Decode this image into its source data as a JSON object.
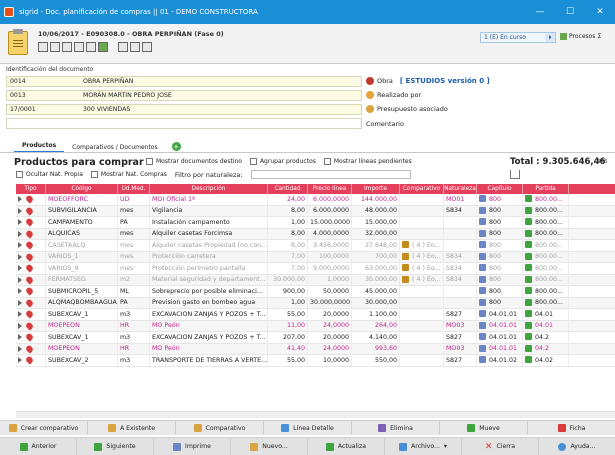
{
  "window": {
    "title": "sigrid - Doc. planificación de compras || 01 - DEMO CONSTRUCTORA",
    "min": "—",
    "max": "☐",
    "close": "✕"
  },
  "header": {
    "doc_title": "10/06/2017 - E090308.0 - OBRA PERPIÑAN (Fase 0)",
    "status": "1 (E) En curso",
    "status_arrow": "⏵",
    "procesos": "Procesos",
    "sigma": "Σ"
  },
  "ident": {
    "label": "Identificación del documento",
    "rows": [
      {
        "code": "0014",
        "name": "OBRA PERPIÑAN"
      },
      {
        "code": "0013",
        "name": "MORÁN MARTIN PEDRO JOSE"
      },
      {
        "code": "17/0001",
        "name": "300 VIVIENDAS"
      },
      {
        "code": "",
        "name": ""
      }
    ],
    "side": {
      "obra": "Obra",
      "estudios": "[ ESTUDIOS versión 0 ]",
      "realizado": "Realizado por",
      "presupuesto": "Presupuesto asociado",
      "comentario": "Comentario"
    }
  },
  "tabs": {
    "productos": "Productos",
    "comparativos": "Comparativos / Documentos",
    "add": "+"
  },
  "products": {
    "title": "Productos para comprar",
    "opt_mostrar_docs": "Mostrar documentos destino",
    "opt_agrupar": "Agrupar productos",
    "opt_lineas": "Mostrar líneas pendientes",
    "opt_ocultar": "Ocultar Nat. Propia",
    "opt_compras": "Mostrar Nat. Compras",
    "filtro": "Filtro por naturaleza:",
    "total": "Total : 9.305.646,46",
    "total_sub": "476"
  },
  "table": {
    "headers": [
      "Tipo",
      "Código",
      "Ud.Med.",
      "Descripción",
      "Cantidad",
      "Precio línea",
      "Importe",
      "Comparativo",
      "Naturaleza",
      "Capítulo",
      "Partida"
    ],
    "rows": [
      {
        "style": "hl",
        "cod": "MOEOFFORC",
        "ud": "UD",
        "desc": "MOI Oficial 1ª",
        "cant": "24,00",
        "prec": "6.000,0000",
        "imp": "144.000,00",
        "comp": "",
        "nat": "MO01",
        "cap": "800",
        "par": "800.00..."
      },
      {
        "style": "",
        "cod": "SUBVIGILANCIA",
        "ud": "mes",
        "desc": "Vigilancia",
        "cant": "8,00",
        "prec": "6.000,0000",
        "imp": "48.000,00",
        "comp": "",
        "nat": "S834",
        "cap": "800",
        "par": "800.00..."
      },
      {
        "style": "",
        "cod": "CAMPAMENTO",
        "ud": "PA",
        "desc": "Instalación campamento",
        "cant": "1,00",
        "prec": "15.000,0000",
        "imp": "15.000,00",
        "comp": "",
        "nat": "",
        "cap": "800",
        "par": "800.00..."
      },
      {
        "style": "",
        "cod": "ALQUICAS",
        "ud": "mes",
        "desc": "Alquiler casetas Forcimsa",
        "cant": "8,00",
        "prec": "4.000,0000",
        "imp": "32.000,00",
        "comp": "",
        "nat": "",
        "cap": "800",
        "par": "800.00..."
      },
      {
        "style": "gray",
        "cod": "CASETAALQ",
        "ud": "mes",
        "desc": "Alquiler casetas Propiedad (no con...",
        "cant": "8,00",
        "prec": "3.456,0000",
        "imp": "27.648,00",
        "comp": "( 4 ) Eo...",
        "nat": "",
        "cap": "800",
        "par": "800.00..."
      },
      {
        "style": "gray",
        "cod": "VARIOS_1",
        "ud": "mes",
        "desc": "Protección carretera",
        "cant": "7,00",
        "prec": "100,0000",
        "imp": "700,00",
        "comp": "( 4 ) Eo...",
        "nat": "S834",
        "cap": "800",
        "par": "800.00..."
      },
      {
        "style": "gray",
        "cod": "VARIOS_9",
        "ud": "mes",
        "desc": "Protección perímetro pantalla",
        "cant": "7,00",
        "prec": "9.000,0000",
        "imp": "63.000,00",
        "comp": "( 4 ) Eo...",
        "nat": "S834",
        "cap": "800",
        "par": "800.00..."
      },
      {
        "style": "gray",
        "cod": "FERMATSEG",
        "ud": "m2",
        "desc": "Material seguridad y departament...",
        "cant": "30.000,00",
        "prec": "1,0000",
        "imp": "30.000,00",
        "comp": "( 4 ) Eo...",
        "nat": "S834",
        "cap": "800",
        "par": "800.00..."
      },
      {
        "style": "",
        "cod": "SUBMICROPIL_5",
        "ud": "ML",
        "desc": "Sobreprecio por posible eliminaci...",
        "cant": "900,00",
        "prec": "50,0000",
        "imp": "45.000,00",
        "comp": "",
        "nat": "",
        "cap": "800",
        "par": "800.00..."
      },
      {
        "style": "",
        "cod": "ALQMAQBOMBAAGUA",
        "ud": "PA",
        "desc": "Prevision gasto en bombeo agua",
        "cant": "1,00",
        "prec": "30.000,0000",
        "imp": "30.000,00",
        "comp": "",
        "nat": "",
        "cap": "800",
        "par": "800.00..."
      },
      {
        "style": "",
        "cod": "SUBEXCAV_1",
        "ud": "m3",
        "desc": "EXCAVACION ZANJAS Y POZOS + T...",
        "cant": "55,00",
        "prec": "20,0000",
        "imp": "1.100,00",
        "comp": "",
        "nat": "S827",
        "cap": "04.01.01",
        "par": "04.01"
      },
      {
        "style": "hl",
        "cod": "MOEPEON",
        "ud": "HR",
        "desc": "MO Peón",
        "cant": "11,00",
        "prec": "24,0000",
        "imp": "264,00",
        "comp": "",
        "nat": "MO03",
        "cap": "04.01.01",
        "par": "04.01"
      },
      {
        "style": "",
        "cod": "SUBEXCAV_1",
        "ud": "m3",
        "desc": "EXCAVACION ZANJAS Y POZOS + T...",
        "cant": "207,00",
        "prec": "20,0000",
        "imp": "4.140,00",
        "comp": "",
        "nat": "S827",
        "cap": "04.01.01",
        "par": "04.2"
      },
      {
        "style": "hl",
        "cod": "MOEPEON",
        "ud": "HR",
        "desc": "MO Peón",
        "cant": "41,40",
        "prec": "24,0000",
        "imp": "993,60",
        "comp": "",
        "nat": "MO03",
        "cap": "04.01.01",
        "par": "04.2"
      },
      {
        "style": "",
        "cod": "SUBEXCAV_2",
        "ud": "m3",
        "desc": "TRANSPORTE DE TIERRAS A VERTE...",
        "cant": "55,00",
        "prec": "10,0000",
        "imp": "550,00",
        "comp": "",
        "nat": "S827",
        "cap": "04.01.02",
        "par": "04.02"
      }
    ]
  },
  "bar1": [
    "Crear comparativo",
    "A Existente",
    "Comparativo",
    "Línea Detalle",
    "Elimina",
    "Mueve",
    "Ficha"
  ],
  "bar2": [
    "Anterior",
    "Siguiente",
    "Imprime",
    "Nuevo...",
    "Actualiza",
    "Archivo...",
    "Cierra",
    "Ayuda..."
  ],
  "colors": {
    "titlebar": "#1b8fd6",
    "table_header": "#e4405c",
    "highlight_text": "#c0238c"
  }
}
